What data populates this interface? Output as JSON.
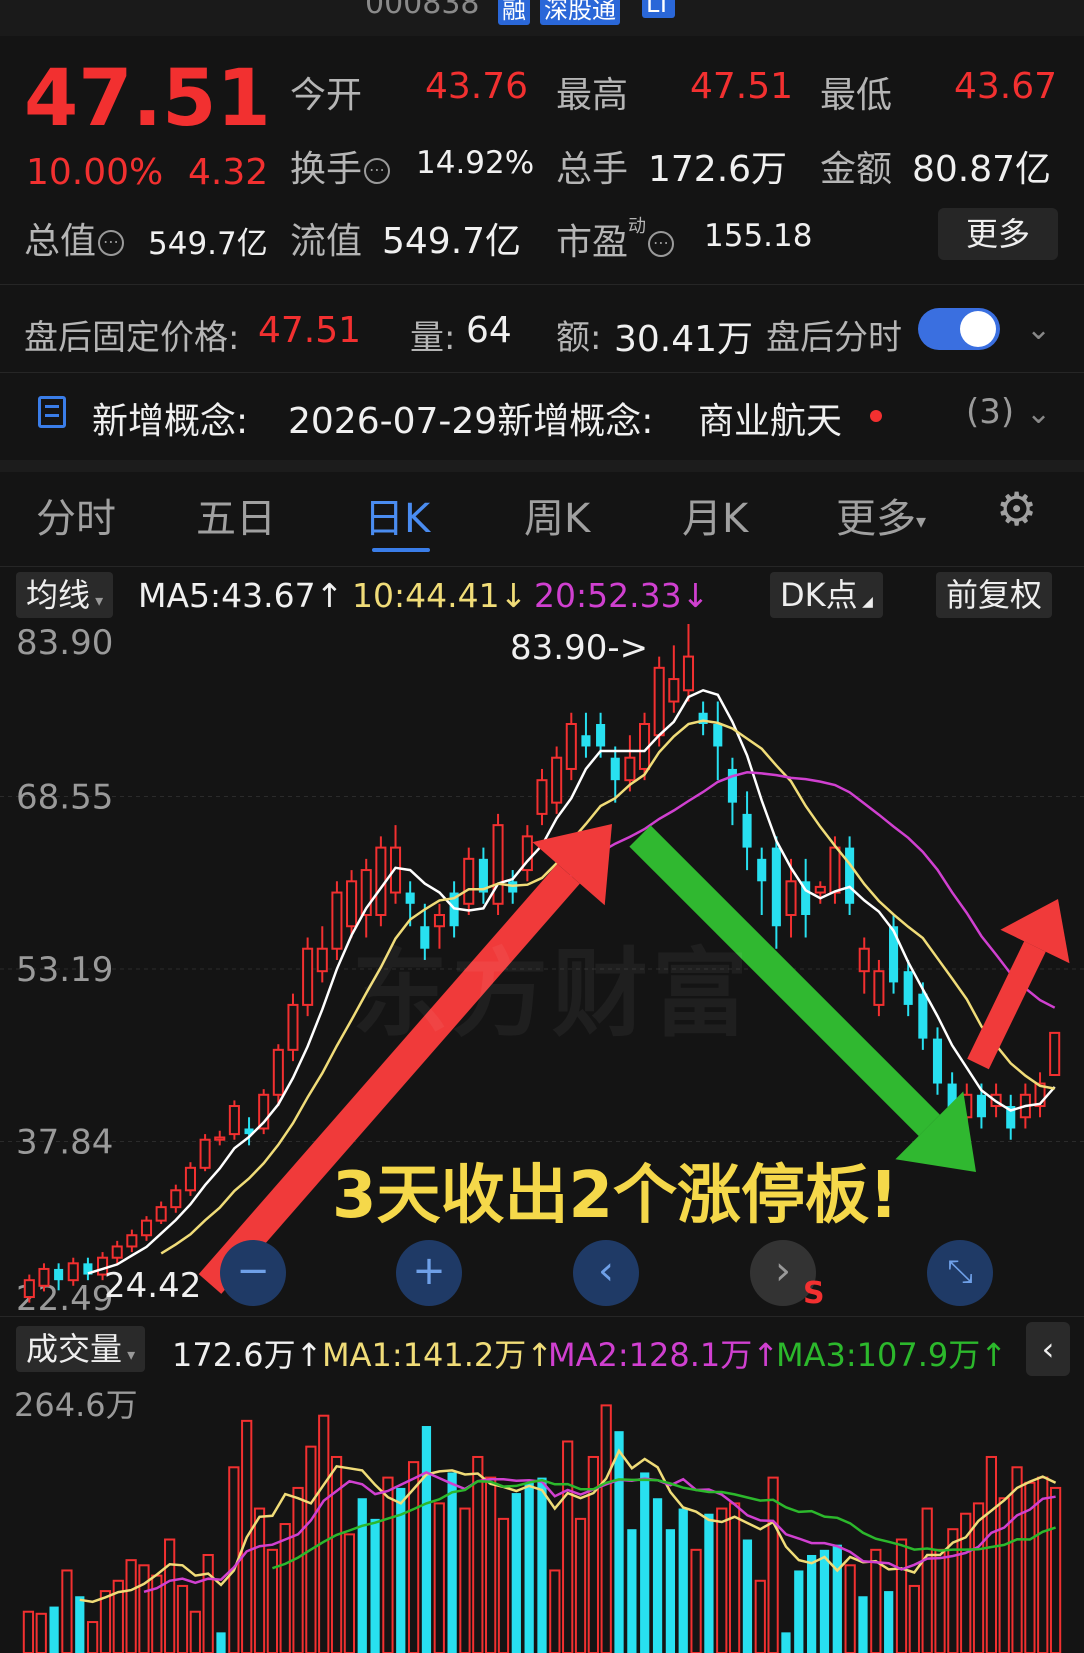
{
  "header": {
    "code": "000838",
    "badges": [
      "融",
      "深股通",
      "LT"
    ]
  },
  "quote": {
    "price": "47.51",
    "change_pct": "10.00%",
    "change": "4.32",
    "open_label": "今开",
    "open": "43.76",
    "high_label": "最高",
    "high": "47.51",
    "low_label": "最低",
    "low": "43.67",
    "turnover_label": "换手",
    "turnover": "14.92%",
    "volume_label": "总手",
    "volume": "172.6万",
    "amount_label": "金额",
    "amount": "80.87亿",
    "mktcap_label": "总值",
    "mktcap": "549.7亿",
    "float_label": "流值",
    "float": "549.7亿",
    "pe_label": "市盈",
    "pe_sup": "动",
    "pe": "155.18",
    "more_label": "更多"
  },
  "afterhours": {
    "price_label": "盘后固定价格:",
    "price": "47.51",
    "vol_label": "量:",
    "vol": "64",
    "amt_label": "额:",
    "amt": "30.41万",
    "toggle_label": "盘后分时",
    "toggle_on": true
  },
  "concept": {
    "label": "新增概念:",
    "text": "2026-07-29新增概念:",
    "name": "商业航天",
    "count": "(3)"
  },
  "tabs": [
    {
      "label": "分时"
    },
    {
      "label": "五日"
    },
    {
      "label": "日K"
    },
    {
      "label": "周K"
    },
    {
      "label": "月K"
    },
    {
      "label": "更多"
    }
  ],
  "ma_bar": {
    "selector": "均线",
    "ma5": "MA5:43.67↑",
    "ma10": "10:44.41↓",
    "ma20": "20:52.33↓",
    "dk": "DK点",
    "fq": "前复权"
  },
  "vol_bar": {
    "selector": "成交量",
    "vol": "172.6万↑",
    "ma1": "MA1:141.2万↑",
    "ma2": "MA2:128.1万↑",
    "ma3": "MA3:107.9万↑"
  },
  "annotation": {
    "text": "3天收出2个涨停板!",
    "high_mark": "83.90->",
    "low_mark": "24.42",
    "watermark": "东方财富",
    "s_mark": "S"
  },
  "colors": {
    "up": "#f23030",
    "down": "#28e0f0",
    "ma5": "#ffffff",
    "ma10": "#f0dc78",
    "ma20": "#d040d0",
    "ma3": "#2cb82c",
    "accent": "#3a7de8"
  },
  "chart_data": [
    {
      "type": "candlestick",
      "title": "",
      "y_ticks": [
        "83.90",
        "68.55",
        "53.19",
        "37.84",
        "22.49"
      ],
      "ylim": [
        22.49,
        83.9
      ],
      "candles": [
        {
          "o": 24,
          "c": 25.5,
          "h": 26,
          "l": 23.5
        },
        {
          "o": 25,
          "c": 26.5,
          "h": 27,
          "l": 24.5
        },
        {
          "o": 26.5,
          "c": 25.5,
          "h": 27,
          "l": 24.6
        },
        {
          "o": 25.5,
          "c": 27,
          "h": 27.5,
          "l": 25
        },
        {
          "o": 27,
          "c": 26,
          "h": 27.5,
          "l": 25.5
        },
        {
          "o": 26,
          "c": 27.5,
          "h": 28,
          "l": 25.5
        },
        {
          "o": 27.5,
          "c": 28.5,
          "h": 29,
          "l": 27
        },
        {
          "o": 28.5,
          "c": 29.5,
          "h": 30,
          "l": 28
        },
        {
          "o": 29.5,
          "c": 30.8,
          "h": 31.2,
          "l": 29
        },
        {
          "o": 30.8,
          "c": 32,
          "h": 32.5,
          "l": 30.5
        },
        {
          "o": 32,
          "c": 33.5,
          "h": 34,
          "l": 31.5
        },
        {
          "o": 33.5,
          "c": 35.5,
          "h": 36,
          "l": 33
        },
        {
          "o": 35.5,
          "c": 38,
          "h": 38.5,
          "l": 35.2
        },
        {
          "o": 38,
          "c": 38.2,
          "h": 38.8,
          "l": 37.5
        },
        {
          "o": 38.5,
          "c": 41,
          "h": 41.5,
          "l": 38
        },
        {
          "o": 39,
          "c": 38.5,
          "h": 40,
          "l": 37.5
        },
        {
          "o": 39,
          "c": 42,
          "h": 42.5,
          "l": 38.5
        },
        {
          "o": 42,
          "c": 46,
          "h": 46.5,
          "l": 41
        },
        {
          "o": 46,
          "c": 50,
          "h": 51,
          "l": 45
        },
        {
          "o": 50,
          "c": 55,
          "h": 56,
          "l": 49
        },
        {
          "o": 53,
          "c": 55,
          "h": 57,
          "l": 52
        },
        {
          "o": 55,
          "c": 60,
          "h": 61,
          "l": 54
        },
        {
          "o": 57,
          "c": 61,
          "h": 62,
          "l": 56
        },
        {
          "o": 58,
          "c": 62,
          "h": 63,
          "l": 56
        },
        {
          "o": 58,
          "c": 64,
          "h": 65,
          "l": 57
        },
        {
          "o": 60,
          "c": 64,
          "h": 66,
          "l": 59
        },
        {
          "o": 60,
          "c": 59,
          "h": 61,
          "l": 57
        },
        {
          "o": 57,
          "c": 55,
          "h": 59,
          "l": 54
        },
        {
          "o": 57,
          "c": 58,
          "h": 59,
          "l": 55
        },
        {
          "o": 60,
          "c": 57,
          "h": 61,
          "l": 56
        },
        {
          "o": 59,
          "c": 63,
          "h": 64,
          "l": 58
        },
        {
          "o": 63,
          "c": 60,
          "h": 64,
          "l": 59
        },
        {
          "o": 59,
          "c": 66,
          "h": 67,
          "l": 58
        },
        {
          "o": 61,
          "c": 60,
          "h": 62,
          "l": 59
        },
        {
          "o": 62,
          "c": 65,
          "h": 66,
          "l": 61
        },
        {
          "o": 67,
          "c": 70,
          "h": 71,
          "l": 66
        },
        {
          "o": 68,
          "c": 72,
          "h": 73,
          "l": 67
        },
        {
          "o": 71,
          "c": 75,
          "h": 76,
          "l": 70
        },
        {
          "o": 74,
          "c": 73,
          "h": 76,
          "l": 72
        },
        {
          "o": 75,
          "c": 73,
          "h": 76,
          "l": 72
        },
        {
          "o": 72,
          "c": 70,
          "h": 73,
          "l": 68
        },
        {
          "o": 70,
          "c": 72,
          "h": 74,
          "l": 69
        },
        {
          "o": 71,
          "c": 75,
          "h": 76,
          "l": 70
        },
        {
          "o": 74,
          "c": 80,
          "h": 81,
          "l": 73
        },
        {
          "o": 77,
          "c": 79,
          "h": 82,
          "l": 76
        },
        {
          "o": 78,
          "c": 81,
          "h": 83.9,
          "l": 77
        },
        {
          "o": 76,
          "c": 75,
          "h": 77,
          "l": 74
        },
        {
          "o": 75,
          "c": 73,
          "h": 77,
          "l": 70
        },
        {
          "o": 71,
          "c": 68,
          "h": 72,
          "l": 66
        },
        {
          "o": 67,
          "c": 64,
          "h": 69,
          "l": 62
        },
        {
          "o": 63,
          "c": 61,
          "h": 64,
          "l": 58
        },
        {
          "o": 64,
          "c": 57,
          "h": 65,
          "l": 55
        },
        {
          "o": 58,
          "c": 61,
          "h": 63,
          "l": 56
        },
        {
          "o": 61,
          "c": 58,
          "h": 63,
          "l": 56
        },
        {
          "o": 60,
          "c": 60.5,
          "h": 61,
          "l": 59
        },
        {
          "o": 60,
          "c": 64,
          "h": 65,
          "l": 59
        },
        {
          "o": 64,
          "c": 59,
          "h": 65,
          "l": 58
        },
        {
          "o": 53,
          "c": 55,
          "h": 56,
          "l": 51
        },
        {
          "o": 50,
          "c": 53,
          "h": 54,
          "l": 49
        },
        {
          "o": 57,
          "c": 52,
          "h": 58,
          "l": 51
        },
        {
          "o": 53,
          "c": 50,
          "h": 54,
          "l": 49
        },
        {
          "o": 51,
          "c": 47,
          "h": 52,
          "l": 46
        },
        {
          "o": 47,
          "c": 43,
          "h": 48,
          "l": 42
        },
        {
          "o": 43,
          "c": 40,
          "h": 44,
          "l": 39
        },
        {
          "o": 40,
          "c": 42,
          "h": 43,
          "l": 39
        },
        {
          "o": 42,
          "c": 40,
          "h": 43,
          "l": 39
        },
        {
          "o": 41,
          "c": 42,
          "h": 43,
          "l": 40
        },
        {
          "o": 41,
          "c": 39,
          "h": 42,
          "l": 38
        },
        {
          "o": 40,
          "c": 42,
          "h": 43,
          "l": 39
        },
        {
          "o": 41,
          "c": 43,
          "h": 44,
          "l": 40
        },
        {
          "o": 43.76,
          "c": 47.51,
          "h": 47.51,
          "l": 43.67
        }
      ]
    },
    {
      "type": "bar",
      "title": "",
      "y_ticks": [
        "264.6万"
      ],
      "ylim": [
        0,
        264.6
      ],
      "series": [
        {
          "name": "volume",
          "values": [
            40,
            38,
            45,
            80,
            55,
            30,
            60,
            70,
            90,
            85,
            75,
            110,
            65,
            40,
            95,
            20,
            180,
            225,
            140,
            100,
            125,
            160,
            200,
            230,
            190,
            115,
            150,
            130,
            170,
            160,
            185,
            220,
            145,
            175,
            140,
            190,
            170,
            130,
            155,
            165,
            170,
            80,
            205,
            130,
            190,
            240,
            215,
            120,
            175,
            150,
            120,
            140,
            100,
            135,
            140,
            145,
            110,
            70,
            170,
            20,
            80,
            95,
            100,
            105,
            85,
            55,
            100,
            60,
            110,
            65,
            140,
            100,
            120,
            135,
            145,
            190,
            150,
            180,
            165,
            170,
            160
          ]
        }
      ]
    }
  ]
}
